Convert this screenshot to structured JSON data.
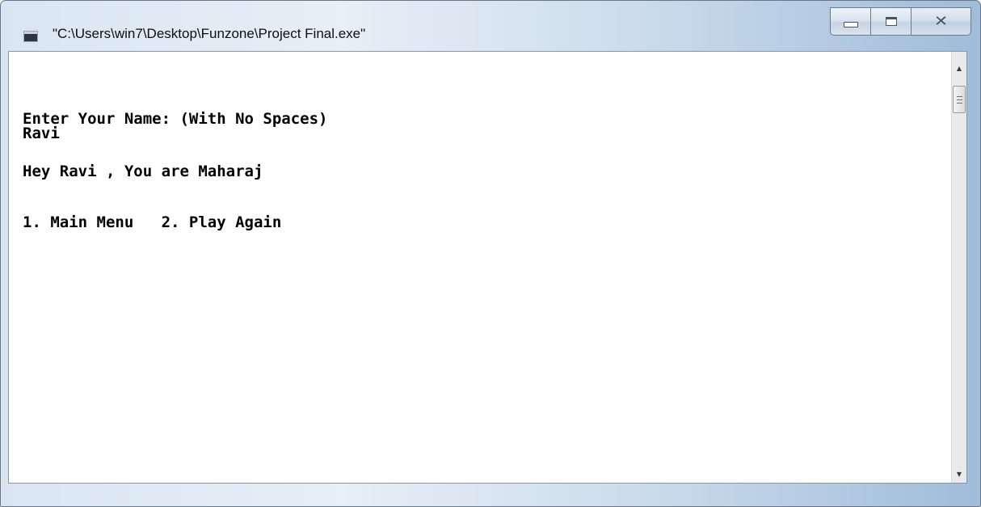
{
  "window": {
    "title": "\"C:\\Users\\win7\\Desktop\\Funzone\\Project Final.exe\"",
    "app_icon": "console-window-icon",
    "caption_buttons": {
      "minimize_icon": "minimize-icon",
      "maximize_icon": "maximize-icon",
      "close_icon": "close-icon",
      "close_glyph": "✕"
    }
  },
  "console": {
    "lines": [
      "Enter Your Name: (With No Spaces)",
      "Ravi",
      "Hey Ravi , You are Maharaj",
      "1. Main Menu   2. Play Again"
    ]
  },
  "scrollbar": {
    "up_glyph": "▲",
    "down_glyph": "▼"
  }
}
